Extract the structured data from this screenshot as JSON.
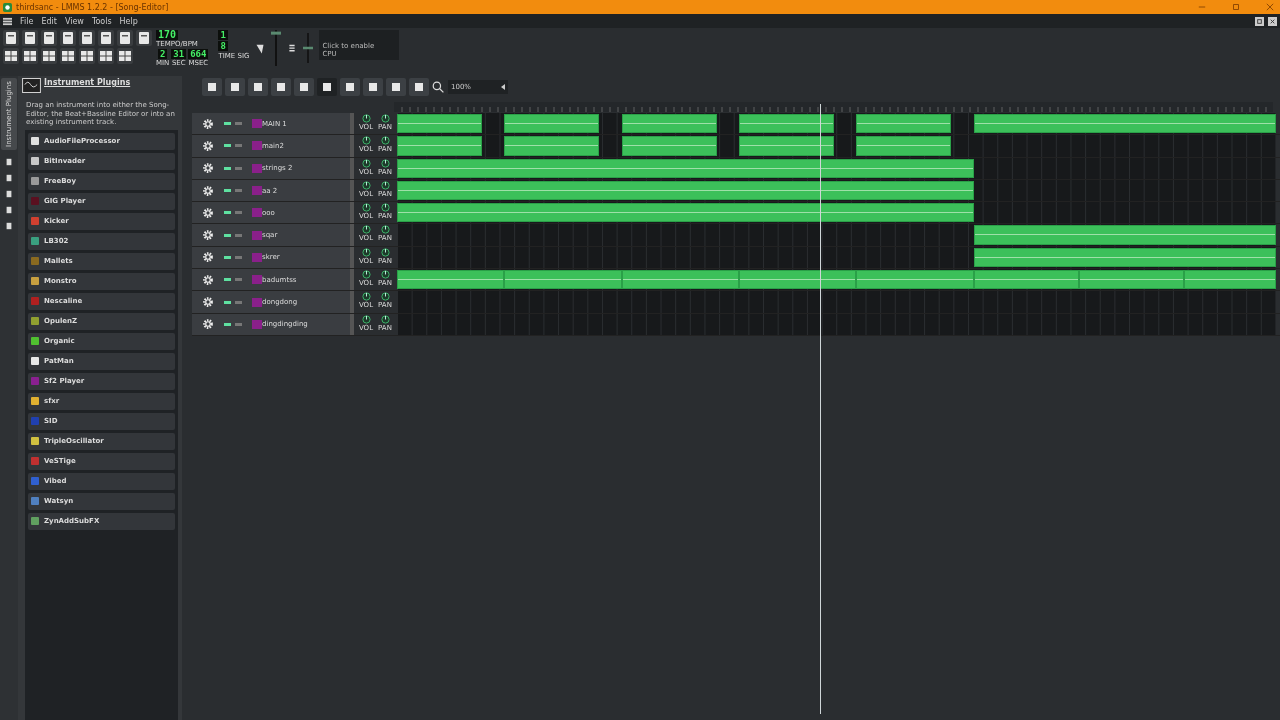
{
  "window": {
    "title": "thirdsanc - LMMS 1.2.2 - [Song-Editor]"
  },
  "menu": [
    "File",
    "Edit",
    "View",
    "Tools",
    "Help"
  ],
  "lcd": {
    "tempo": "170",
    "tempo_label": "TEMPO/BPM",
    "min": "2",
    "sec": "31",
    "msec": "664",
    "min_label": "MIN",
    "sec_label": "SEC",
    "msec_label": "MSEC",
    "sig_num": "1",
    "sig_den": "8",
    "sig_label": "TIME SIG"
  },
  "master_volume": {
    "level": 0.95
  },
  "master_pitch": {
    "level": 0.5
  },
  "cpu": {
    "hint": "Click to enable",
    "label": "CPU"
  },
  "side_tabs": [
    {
      "label": "Instrument Plugins",
      "selected": true
    }
  ],
  "plugin_panel": {
    "title": "Instrument Plugins",
    "description": "Drag an instrument into either the Song-Editor, the Beat+Bassline Editor or into an existing instrument track.",
    "plugins": [
      {
        "name": "AudioFileProcessor",
        "color": "#e0e0e0"
      },
      {
        "name": "BitInvader",
        "color": "#c8c8c8"
      },
      {
        "name": "FreeBoy",
        "color": "#9a9a9a"
      },
      {
        "name": "GIG Player",
        "color": "#5a1020"
      },
      {
        "name": "Kicker",
        "color": "#d04030"
      },
      {
        "name": "LB302",
        "color": "#3aa080"
      },
      {
        "name": "Mallets",
        "color": "#8a6a20"
      },
      {
        "name": "Monstro",
        "color": "#c8a040"
      },
      {
        "name": "Nescaline",
        "color": "#b02020"
      },
      {
        "name": "OpulenZ",
        "color": "#90a030"
      },
      {
        "name": "Organic",
        "color": "#50c030"
      },
      {
        "name": "PatMan",
        "color": "#e8e8e8"
      },
      {
        "name": "Sf2 Player",
        "color": "#8a2090"
      },
      {
        "name": "sfxr",
        "color": "#e0b030"
      },
      {
        "name": "SID",
        "color": "#2040b0"
      },
      {
        "name": "TripleOscillator",
        "color": "#d0c040"
      },
      {
        "name": "VeSTige",
        "color": "#c03030"
      },
      {
        "name": "Vibed",
        "color": "#3060d0"
      },
      {
        "name": "Watsyn",
        "color": "#5080c0"
      },
      {
        "name": "ZynAddSubFX",
        "color": "#60a060"
      }
    ]
  },
  "song_editor": {
    "zoom": "100%",
    "tracks": [
      {
        "name": "MAIN 1",
        "muted": false,
        "knob_labels": [
          "VOL",
          "PAN"
        ]
      },
      {
        "name": "main2",
        "muted": false,
        "knob_labels": [
          "VOL",
          "PAN"
        ]
      },
      {
        "name": "strings 2",
        "muted": false,
        "knob_labels": [
          "VOL",
          "PAN"
        ]
      },
      {
        "name": "aa 2",
        "muted": false,
        "knob_labels": [
          "VOL",
          "PAN"
        ]
      },
      {
        "name": "ooo",
        "muted": false,
        "knob_labels": [
          "VOL",
          "PAN"
        ]
      },
      {
        "name": "sqar",
        "muted": false,
        "knob_labels": [
          "VOL",
          "PAN"
        ]
      },
      {
        "name": "skrer",
        "muted": false,
        "knob_labels": [
          "VOL",
          "PAN"
        ]
      },
      {
        "name": "badumtss",
        "muted": false,
        "knob_labels": [
          "VOL",
          "PAN"
        ]
      },
      {
        "name": "dongdong",
        "muted": false,
        "knob_labels": [
          "VOL",
          "PAN"
        ]
      },
      {
        "name": "dingdingding",
        "muted": false,
        "knob_labels": [
          "VOL",
          "PAN"
        ]
      }
    ]
  }
}
